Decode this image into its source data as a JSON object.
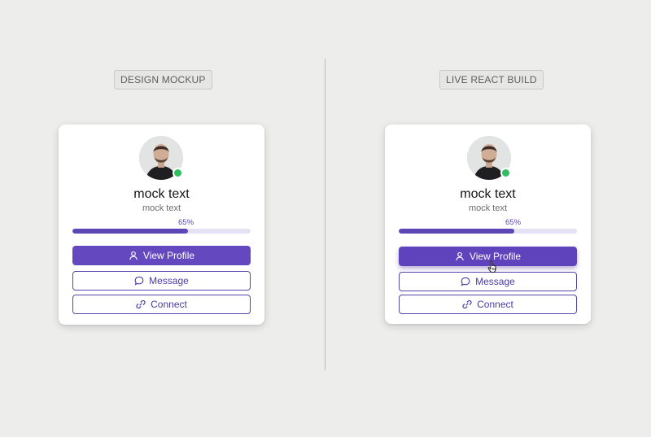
{
  "panels": [
    {
      "tag": "DESIGN MOCKUP",
      "card": {
        "name": "mock text",
        "subtitle": "mock text",
        "progress": {
          "label": "65%",
          "value": 0.65
        },
        "buttons": {
          "primary": "View Profile",
          "message": "Message",
          "connect": "Connect"
        },
        "status": "online"
      }
    },
    {
      "tag": "LIVE REACT BUILD",
      "card": {
        "name": "mock text",
        "subtitle": "mock text",
        "progress": {
          "label": "65%",
          "value": 0.65
        },
        "buttons": {
          "primary": "View Profile",
          "message": "Message",
          "connect": "Connect"
        },
        "status": "online"
      }
    }
  ],
  "icons": {
    "primary": "user-icon",
    "message": "chat-bubble-icon",
    "connect": "link-icon",
    "cursor": "hand-pointer-icon"
  },
  "colors": {
    "accent": "#6448c0",
    "track": "#e5e2f6",
    "status_online": "#2fbf5f",
    "background": "#ededeb"
  }
}
